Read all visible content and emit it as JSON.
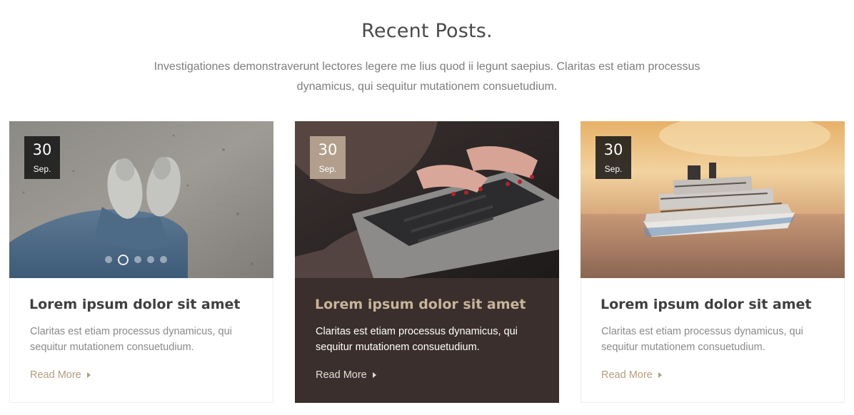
{
  "section": {
    "title": "Recent Posts.",
    "description": "Investigationes demonstraverunt lectores legere me lius quod ii legunt saepius. Claritas est etiam processus dynamicus, qui sequitur mutationem consuetudium."
  },
  "posts": [
    {
      "date_day": "30",
      "date_month": "Sep.",
      "title": "Lorem ipsum dolor sit amet",
      "excerpt": "Claritas est etiam processus dynamicus, qui sequitur mutationem consuetudium.",
      "read_more": "Read More",
      "image": "feet-on-sand-photo"
    },
    {
      "date_day": "30",
      "date_month": "Sep.",
      "title": "Lorem ipsum dolor sit amet",
      "excerpt": "Claritas est etiam processus dynamicus, qui sequitur mutationem consuetudium.",
      "read_more": "Read More",
      "image": "typing-on-laptop-photo"
    },
    {
      "date_day": "30",
      "date_month": "Sep.",
      "title": "Lorem ipsum dolor sit amet",
      "excerpt": "Claritas est etiam processus dynamicus, qui sequitur mutationem consuetudium.",
      "read_more": "Read More",
      "image": "cruise-ship-photo"
    }
  ],
  "slider": {
    "dot_count": 5,
    "active_index": 1
  },
  "colors": {
    "accent": "#b59c7e",
    "highlight_card_bg": "#3a2f2c",
    "date_badge_dark": "#141414",
    "date_badge_tan": "#b19f8c"
  }
}
